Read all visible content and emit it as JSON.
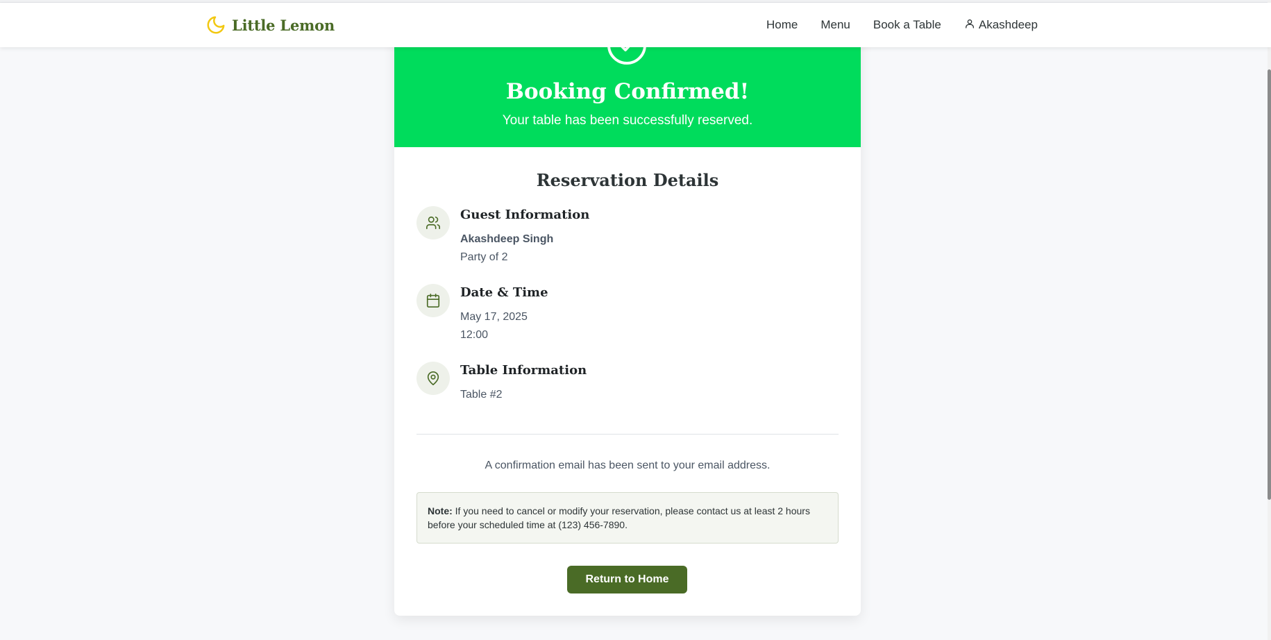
{
  "brand": {
    "name": "Little Lemon",
    "icon": "moon-icon",
    "icon_color": "#f2c811",
    "color": "#4a6b26"
  },
  "nav": {
    "links": [
      "Home",
      "Menu",
      "Book a Table"
    ],
    "user": {
      "icon": "user-icon",
      "name": "Akashdeep"
    }
  },
  "hero": {
    "icon": "check-circle-icon",
    "title": "Booking Confirmed!",
    "subtitle": "Your table has been successfully reserved.",
    "background": "#00dc5c"
  },
  "details": {
    "title": "Reservation Details",
    "guest": {
      "icon": "users-icon",
      "title": "Guest Information",
      "name": "Akashdeep Singh",
      "party": "Party of 2"
    },
    "datetime": {
      "icon": "calendar-icon",
      "title": "Date & Time",
      "date": "May 17, 2025",
      "time": "12:00"
    },
    "table": {
      "icon": "map-pin-icon",
      "title": "Table Information",
      "value": "Table #2"
    }
  },
  "email_message": "A confirmation email has been sent to your email address.",
  "note": {
    "label": "Note:",
    "text": "If you need to cancel or modify your reservation, please contact us at least 2 hours before your scheduled time at (123) 456-7890."
  },
  "return_button": {
    "label": "Return to Home",
    "color": "#4a6b26"
  }
}
